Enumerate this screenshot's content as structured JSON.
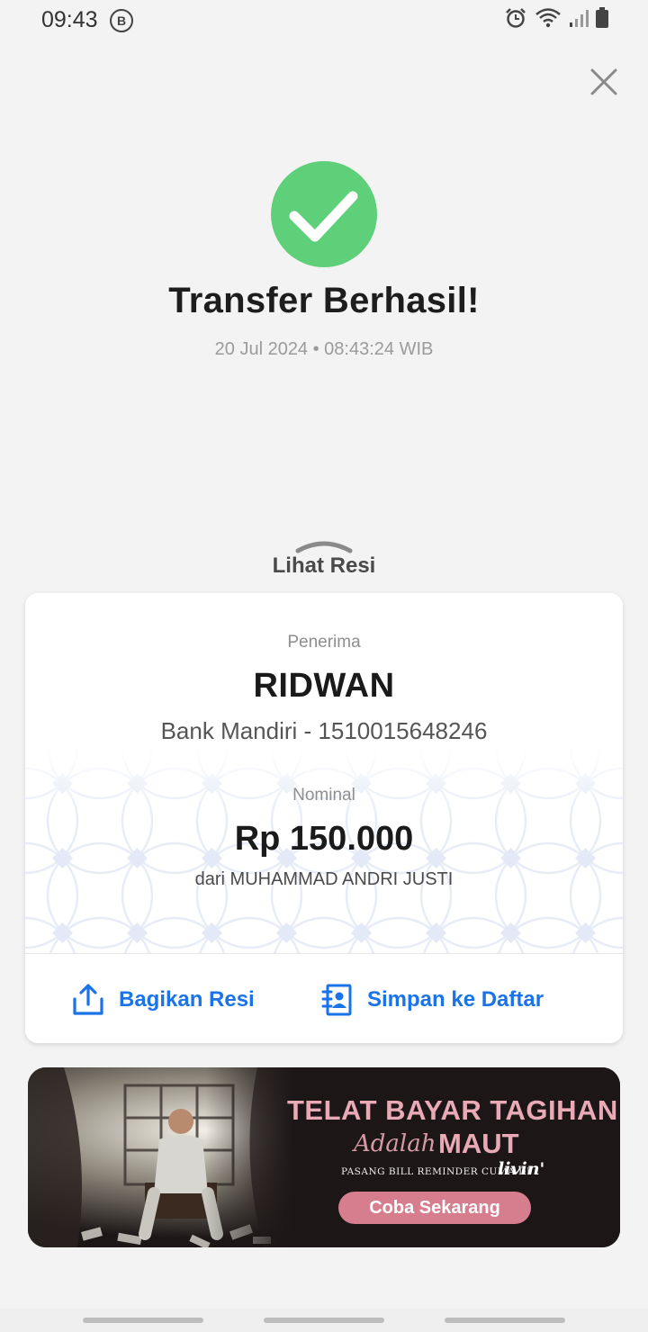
{
  "status_bar": {
    "time": "09:43",
    "badge": "B",
    "icons": [
      "alarm-icon",
      "wifi-icon",
      "signal-icon",
      "battery-icon"
    ]
  },
  "header": {
    "close_icon": "close-icon"
  },
  "result": {
    "title": "Transfer Berhasil!",
    "timestamp": "20 Jul 2024 • 08:43:24 WIB",
    "status_color": "#5fd07a"
  },
  "receipt_toggle": {
    "label": "Lihat Resi"
  },
  "receipt": {
    "recipient_label": "Penerima",
    "recipient_name": "RIDWAN",
    "recipient_bank": "Bank Mandiri - 1510015648246",
    "amount_label": "Nominal",
    "amount": "Rp 150.000",
    "sender": "dari MUHAMMAD ANDRI JUSTI"
  },
  "actions": {
    "share_label": "Bagikan Resi",
    "save_label": "Simpan ke Daftar",
    "accent_color": "#1a73e8"
  },
  "banner": {
    "title": "TELAT BAYAR TAGIHAN",
    "script": "Adalah",
    "emphasis": "MAUT",
    "subtitle": "PASANG BILL REMINDER CUMA DI",
    "brand": "livin'",
    "cta": "Coba Sekarang"
  }
}
